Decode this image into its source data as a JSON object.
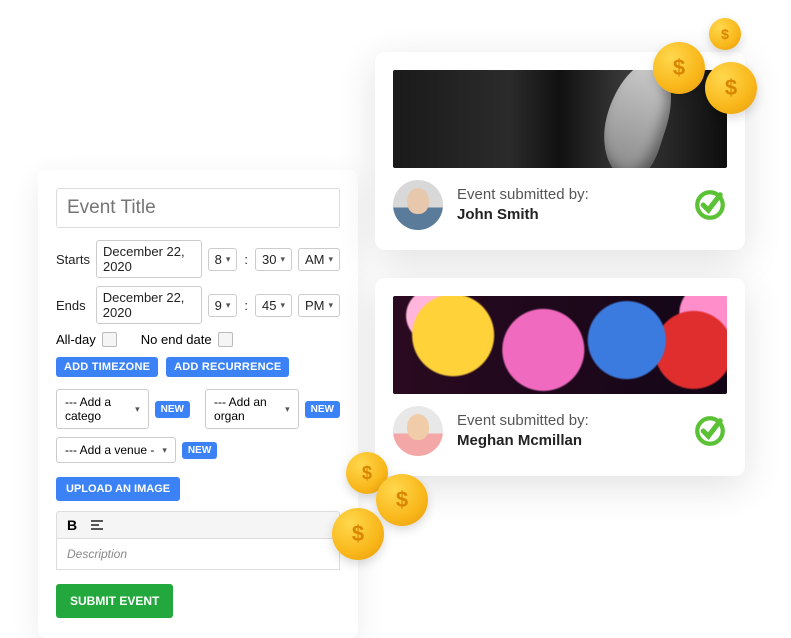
{
  "form": {
    "title_placeholder": "Event Title",
    "starts_label": "Starts",
    "ends_label": "Ends",
    "start_date": "December 22, 2020",
    "start_hour": "8",
    "start_min": "30",
    "start_ampm": "AM",
    "end_date": "December 22, 2020",
    "end_hour": "9",
    "end_min": "45",
    "end_ampm": "PM",
    "allday_label": "All-day",
    "noend_label": "No end date",
    "add_timezone": "ADD TIMEZONE",
    "add_recurrence": "ADD RECURRENCE",
    "add_category": "--- Add a catego",
    "add_organizer": "--- Add an organ",
    "add_venue": "--- Add a venue -",
    "new_badge": "NEW",
    "upload_image": "UPLOAD AN IMAGE",
    "bold_btn": "B",
    "description_placeholder": "Description",
    "submit": "SUBMIT EVENT"
  },
  "cards": [
    {
      "submitted_label": "Event submitted by:",
      "name": "John Smith"
    },
    {
      "submitted_label": "Event submitted by:",
      "name": "Meghan Mcmillan"
    }
  ],
  "icons": {
    "dollar": "$"
  }
}
